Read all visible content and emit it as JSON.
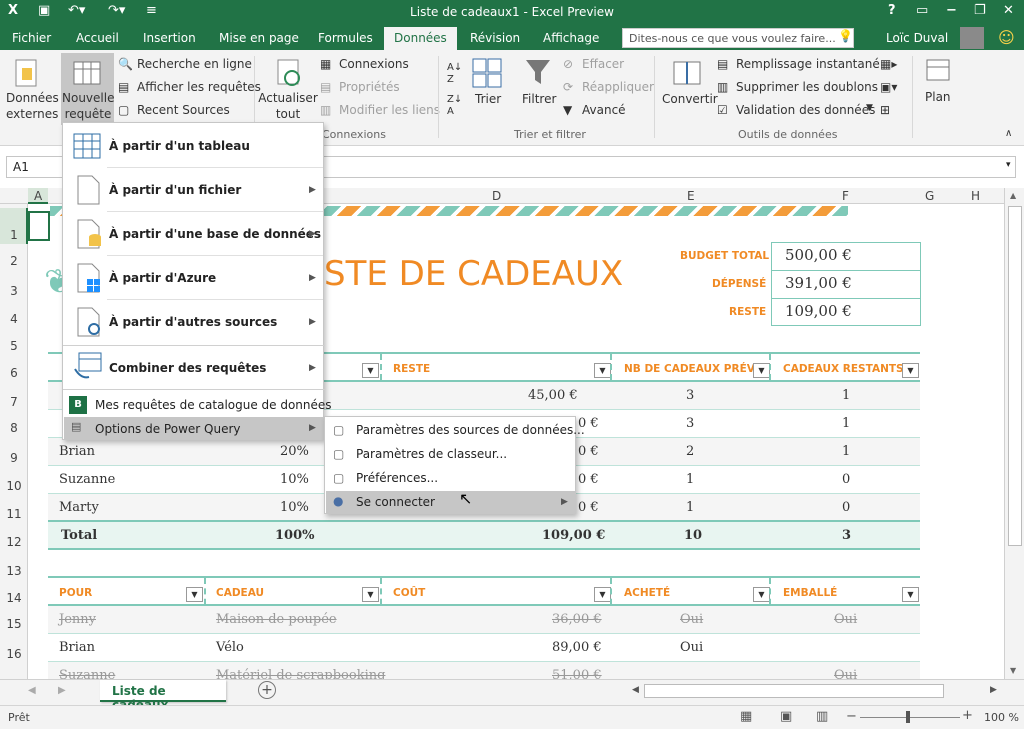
{
  "window": {
    "title": "Liste de cadeaux1 - Excel Preview",
    "user": "Loïc Duval",
    "help": "?"
  },
  "tabs": [
    "Fichier",
    "Accueil",
    "Insertion",
    "Mise en page",
    "Formules",
    "Données",
    "Révision",
    "Affichage"
  ],
  "tell_me": "Dites-nous ce que vous voulez faire...",
  "ribbon": {
    "donnees_externes": "Données externes",
    "nouvelle_requete": "Nouvelle requête",
    "recherche_en_ligne": "Recherche en ligne",
    "afficher_requetes": "Afficher les requêtes",
    "recent_sources": "Recent Sources",
    "actualiser_tout": "Actualiser tout",
    "connexions": "Connexions",
    "proprietes": "Propriétés",
    "modifier_liens": "Modifier les liens",
    "group_connexions": "Connexions",
    "trier": "Trier",
    "filtrer": "Filtrer",
    "effacer": "Effacer",
    "reappliquer": "Réappliquer",
    "avance": "Avancé",
    "group_trier": "Trier et filtrer",
    "convertir": "Convertir",
    "remplissage": "Remplissage instantané",
    "supprimer_doublons": "Supprimer les doublons",
    "validation": "Validation des données",
    "group_outils": "Outils de données",
    "plan": "Plan"
  },
  "namebox": "A1",
  "columns": [
    "A",
    "B",
    "C",
    "D",
    "E",
    "F",
    "G",
    "H"
  ],
  "rows": [
    "1",
    "2",
    "3",
    "4",
    "5",
    "6",
    "7",
    "8",
    "9",
    "10",
    "11",
    "12",
    "13",
    "14",
    "15",
    "16"
  ],
  "sheet": {
    "title": "LISTE DE CADEAUX",
    "title_visible": "STE DE CADEAUX",
    "budget_total_label": "BUDGET TOTAL",
    "budget_total": "500,00 €",
    "depense_label": "DÉPENSÉ",
    "depense": "391,00 €",
    "reste_label": "RESTE",
    "reste": "109,00 €",
    "t1_headers": [
      "T",
      "RESTE",
      "NB DE CADEAUX PRÉVUS",
      "CADEAUX RESTANTS"
    ],
    "t1_rows": [
      {
        "name": "",
        "pct": "",
        "reste": "45,00 €",
        "nb": "3",
        "restants": "1"
      },
      {
        "name": "",
        "pct": "",
        "reste": "0 €",
        "nb": "3",
        "restants": "1"
      },
      {
        "name": "Brian",
        "pct": "20%",
        "reste": "0 €",
        "nb": "2",
        "restants": "1"
      },
      {
        "name": "Suzanne",
        "pct": "10%",
        "reste": "0 €",
        "nb": "1",
        "restants": "0"
      },
      {
        "name": "Marty",
        "pct": "10%",
        "reste": "0 €",
        "nb": "1",
        "restants": "0"
      }
    ],
    "t1_total": {
      "label": "Total",
      "pct": "100%",
      "reste": "109,00 €",
      "nb": "10",
      "restants": "3"
    },
    "t2_headers": [
      "POUR",
      "CADEAU",
      "COÛT",
      "ACHETÉ",
      "EMBALLÉ"
    ],
    "t2_rows": [
      {
        "pour": "Jenny",
        "cadeau": "Maison de poupée",
        "cout": "36,00 €",
        "achete": "Oui",
        "emballe": "Oui"
      },
      {
        "pour": "Brian",
        "cadeau": "Vélo",
        "cout": "89,00 €",
        "achete": "Oui",
        "emballe": ""
      },
      {
        "pour": "Suzanne",
        "cadeau": "Matériel de scrapbooking",
        "cout": "51,00 €",
        "achete": "",
        "emballe": "Oui"
      }
    ]
  },
  "menu": {
    "items": [
      "À partir d'un tableau",
      "À partir d'un fichier",
      "À partir d'une base de données",
      "À partir d'Azure",
      "À partir d'autres sources",
      "Combiner des requêtes"
    ],
    "catalogue": "Mes requêtes de catalogue de données",
    "options": "Options de Power Query"
  },
  "submenu": [
    "Paramètres des sources de données...",
    "Paramètres de classeur...",
    "Préférences...",
    "Se connecter"
  ],
  "sheet_tab": "Liste de cadeaux",
  "status": {
    "ready": "Prêt",
    "zoom": "100 %"
  }
}
